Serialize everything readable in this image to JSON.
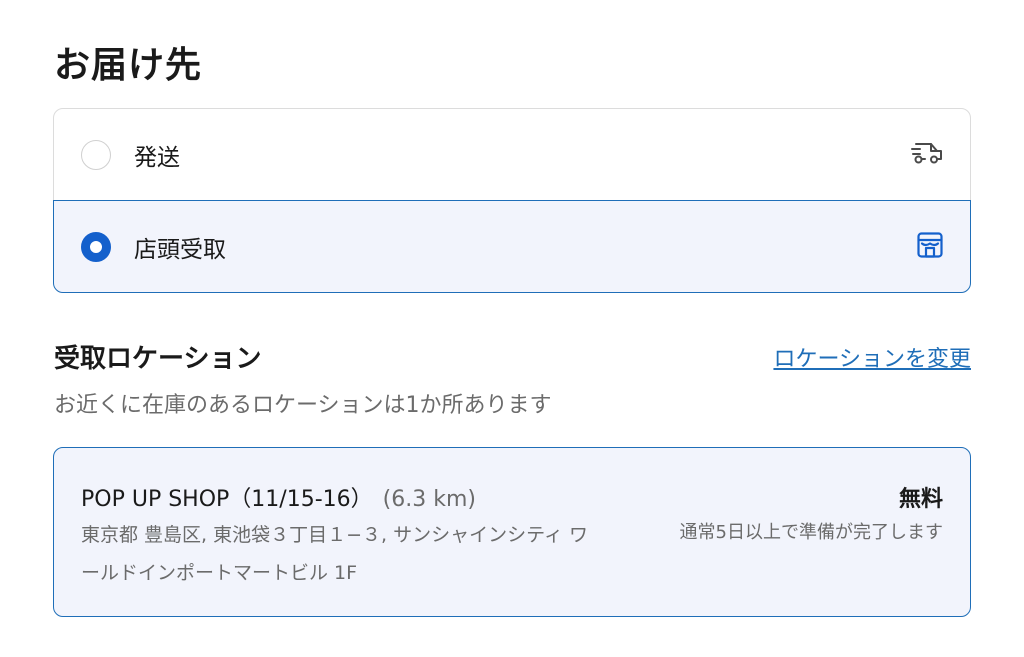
{
  "delivery": {
    "title": "お届け先",
    "options": [
      {
        "label": "発送",
        "icon": "truck-icon",
        "selected": false
      },
      {
        "label": "店頭受取",
        "icon": "store-icon",
        "selected": true
      }
    ]
  },
  "pickup": {
    "section_title": "受取ロケーション",
    "change_link": "ロケーションを変更",
    "subtitle": "お近くに在庫のあるロケーションは1か所あります",
    "location": {
      "name": "POP UP SHOP（11/15-16）",
      "distance": "(6.3 km)",
      "address": "東京都 豊島区, 東池袋３丁目１−３, サンシャインシティ ワールドインポートマートビル 1F",
      "price": "無料",
      "ready_time": "通常5日以上で準備が完了します"
    }
  },
  "colors": {
    "accent": "#1f6eb8",
    "radio_selected": "#1460cc",
    "selected_bg": "#f2f4fc",
    "muted_text": "#6b6b6b"
  }
}
